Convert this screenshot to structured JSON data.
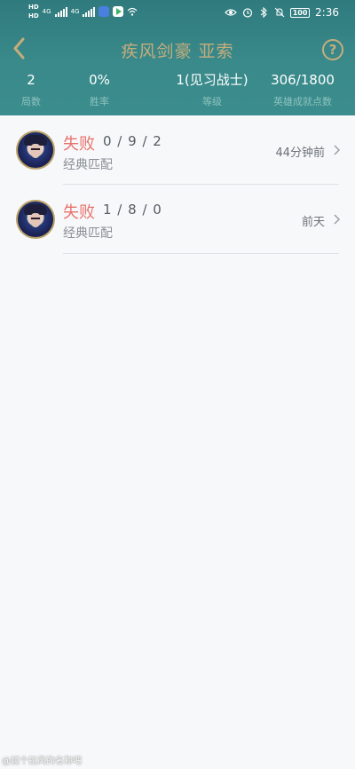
{
  "status_bar": {
    "hd1": "HD",
    "hd2": "HD",
    "net1": "4G",
    "net2": "4G",
    "battery": "100",
    "time": "2:36"
  },
  "header": {
    "title": "疾风剑豪 亚索",
    "help": "?"
  },
  "stats": [
    {
      "value": "2",
      "label": "局数"
    },
    {
      "value": "0%",
      "label": "胜率"
    },
    {
      "value": "1(见习战士)",
      "label": "等级"
    },
    {
      "value": "306/1800",
      "label": "英雄成就点数"
    }
  ],
  "matches": [
    {
      "result": "失败",
      "kda": "0 / 9 / 2",
      "mode": "经典匹配",
      "time": "44分钟前"
    },
    {
      "result": "失败",
      "kda": "1 / 8 / 0",
      "mode": "经典匹配",
      "time": "前天"
    }
  ],
  "watermark": "@起个拉风的名称吧",
  "colors": {
    "header_bg": "#3a8a8b",
    "title_gold": "#c5ad7c",
    "loss_red": "#e8736c"
  }
}
